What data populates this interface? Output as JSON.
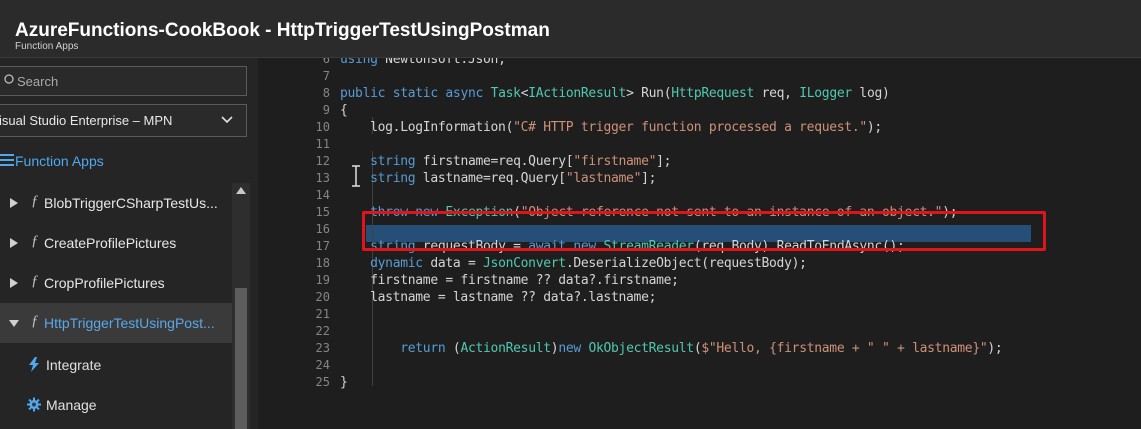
{
  "header": {
    "title": "AzureFunctions-CookBook - HttpTriggerTestUsingPostman",
    "subtitle": "Function Apps"
  },
  "sidebar": {
    "search_placeholder": "Search",
    "subscription": "isual Studio Enterprise – MPN",
    "section_label": "Function Apps",
    "items": [
      {
        "label": "BlobTriggerCSharpTestUs...",
        "icon": "function-icon",
        "expanded": false
      },
      {
        "label": "CreateProfilePictures",
        "icon": "function-icon",
        "expanded": false
      },
      {
        "label": "CropProfilePictures",
        "icon": "function-icon",
        "expanded": false
      },
      {
        "label": "HttpTriggerTestUsingPost...",
        "icon": "function-icon",
        "expanded": true,
        "active": true
      }
    ],
    "subitems": [
      {
        "label": "Integrate",
        "icon": "lightning-icon"
      },
      {
        "label": "Manage",
        "icon": "gear-icon"
      }
    ]
  },
  "editor": {
    "line_numbers": [
      "6",
      "7",
      "8",
      "9",
      "10",
      "11",
      "12",
      "13",
      "14",
      "15",
      "16",
      "17",
      "18",
      "19",
      "20",
      "21",
      "22",
      "23",
      "24",
      "25"
    ],
    "lines": [
      "using Newtonsoft.Json;",
      "",
      "public static async Task<IActionResult> Run(HttpRequest req, ILogger log)",
      "{",
      "    log.LogInformation(\"C# HTTP trigger function processed a request.\");",
      "",
      "    string firstname=req.Query[\"firstname\"];",
      "    string lastname=req.Query[\"lastname\"];",
      "",
      "    throw new Exception(\"Object reference not sent to an instance of an object.\");",
      "",
      "    string requestBody = await new StreamReader(req.Body).ReadToEndAsync();",
      "    dynamic data = JsonConvert.DeserializeObject(requestBody);",
      "    firstname = firstname ?? data?.firstname;",
      "    lastname = lastname ?? data?.lastname;",
      "",
      "",
      "        return (ActionResult)new OkObjectResult($\"Hello, {firstname + \" \" + lastname}\");",
      "",
      "}"
    ],
    "highlighted_line": "15",
    "colors": {
      "keyword": "#569cd6",
      "type": "#4ec9b0",
      "string": "#ce9178",
      "selection": "#264f78",
      "annotation_box": "#e0141b"
    }
  }
}
